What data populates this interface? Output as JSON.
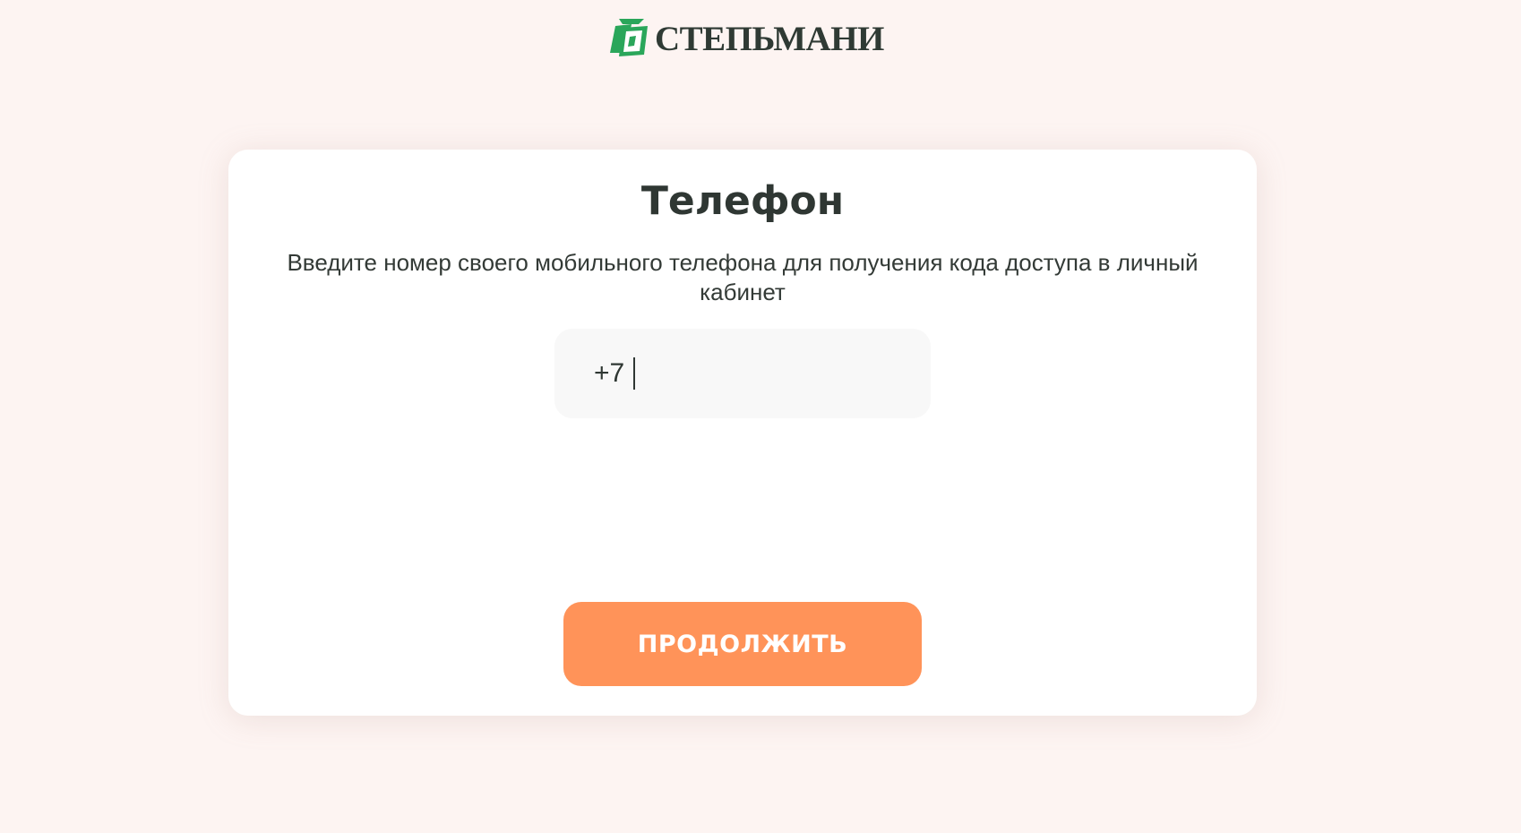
{
  "brand": {
    "name": "СТЕПЬМАНИ",
    "logo_icon": "money-bill-icon",
    "color": "#2aa65a"
  },
  "card": {
    "title": "Телефон",
    "subtitle": "Введите номер своего мобильного телефона для получения кода доступа в личный кабинет"
  },
  "phone": {
    "prefix": "+7",
    "value": "",
    "placeholder": ""
  },
  "actions": {
    "continue_label": "ПРОДОЛЖИТЬ",
    "continue_color": "#ff9359"
  },
  "colors": {
    "background": "#fdf4f2",
    "text": "#2f3733"
  }
}
